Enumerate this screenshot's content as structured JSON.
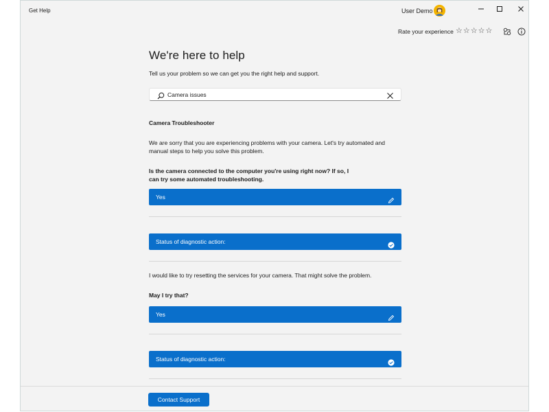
{
  "window": {
    "title": "Get Help",
    "user_name": "User Demo",
    "controls": {
      "minimize": "—",
      "maximize": "☐",
      "close": "✕"
    }
  },
  "toolbar": {
    "rate_label": "Rate your experience",
    "stars": [
      "☆",
      "☆",
      "☆",
      "☆",
      "☆"
    ],
    "rating": 0,
    "icons": [
      "share-icon",
      "info-icon"
    ]
  },
  "main": {
    "heading": "We're here to help",
    "subheading": "Tell us your problem so we can get you the right help and support.",
    "search": {
      "value": "Camera issues",
      "placeholder": ""
    },
    "section_title": "Camera Troubleshooter",
    "intro": "We are sorry that you are experiencing problems with your camera. Let's try automated and manual steps to help you solve this problem.",
    "question_1": "Is the camera connected to the computer you're using right now? If so, I can try some automated troubleshooting.",
    "answer_1": "Yes",
    "status_1": "Status of diagnostic action:",
    "reset_text": "I would like to try resetting the services for your camera. That might solve the problem.",
    "question_2": "May I try that?",
    "answer_2": "Yes",
    "status_2": "Status of diagnostic action:"
  },
  "footer": {
    "contact_label": "Contact Support"
  },
  "colors": {
    "accent": "#0a6fcb",
    "background": "#f3f3f3",
    "avatar": "#f4b400"
  }
}
